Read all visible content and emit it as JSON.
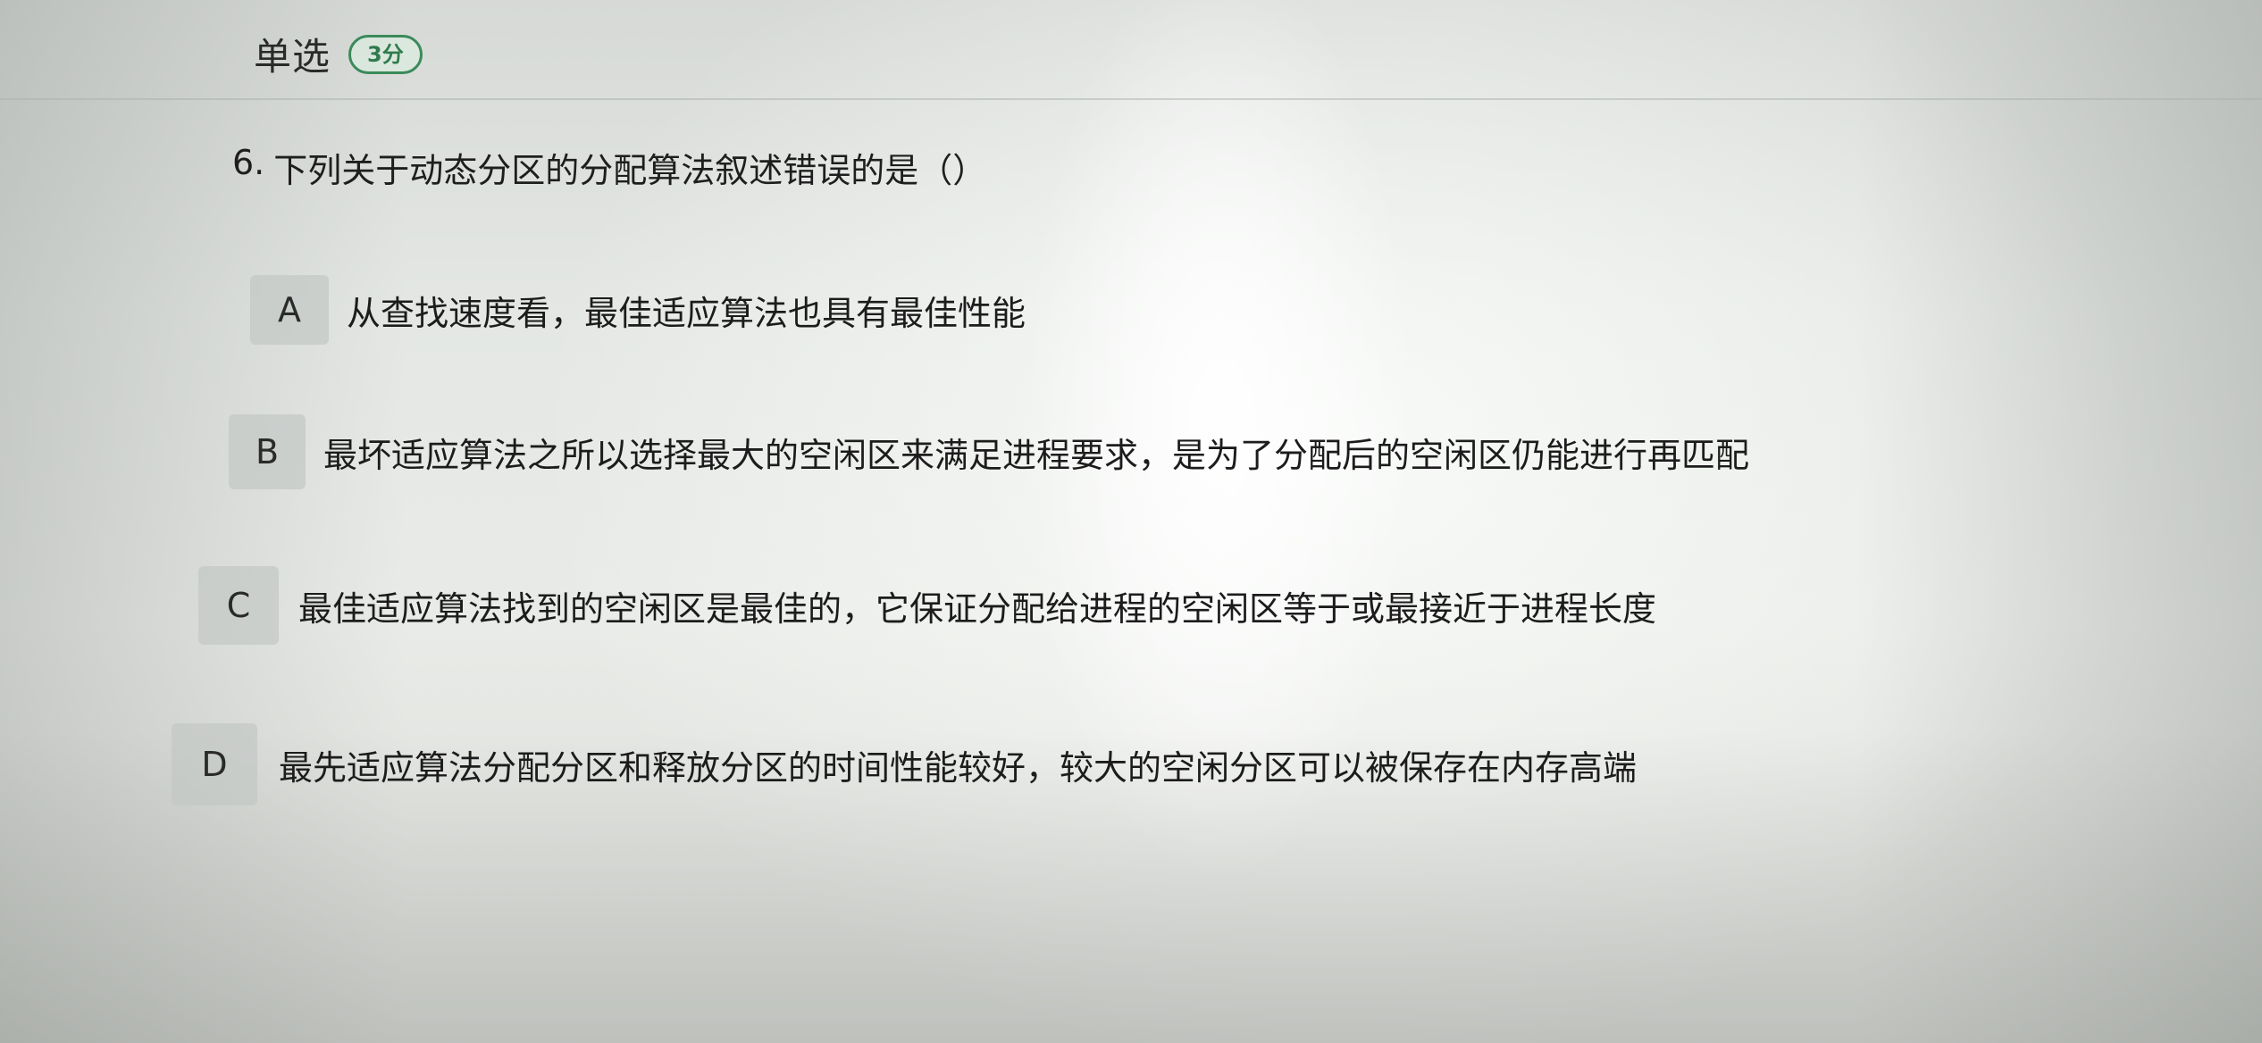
{
  "header": {
    "question_type": "单选",
    "score": "3分"
  },
  "question": {
    "number": "6.",
    "text": "下列关于动态分区的分配算法叙述错误的是（）"
  },
  "options": [
    {
      "letter": "A",
      "text": "从查找速度看，最佳适应算法也具有最佳性能"
    },
    {
      "letter": "B",
      "text": "最坏适应算法之所以选择最大的空闲区来满足进程要求，是为了分配后的空闲区仍能进行再匹配"
    },
    {
      "letter": "C",
      "text": "最佳适应算法找到的空闲区是最佳的，它保证分配给进程的空闲区等于或最接近于进程长度"
    },
    {
      "letter": "D",
      "text": "最先适应算法分配分区和释放分区的时间性能较好，较大的空闲分区可以被保存在内存高端"
    }
  ],
  "colors": {
    "badge": "#2f7a4c",
    "option_box": "#c3c8c4"
  }
}
